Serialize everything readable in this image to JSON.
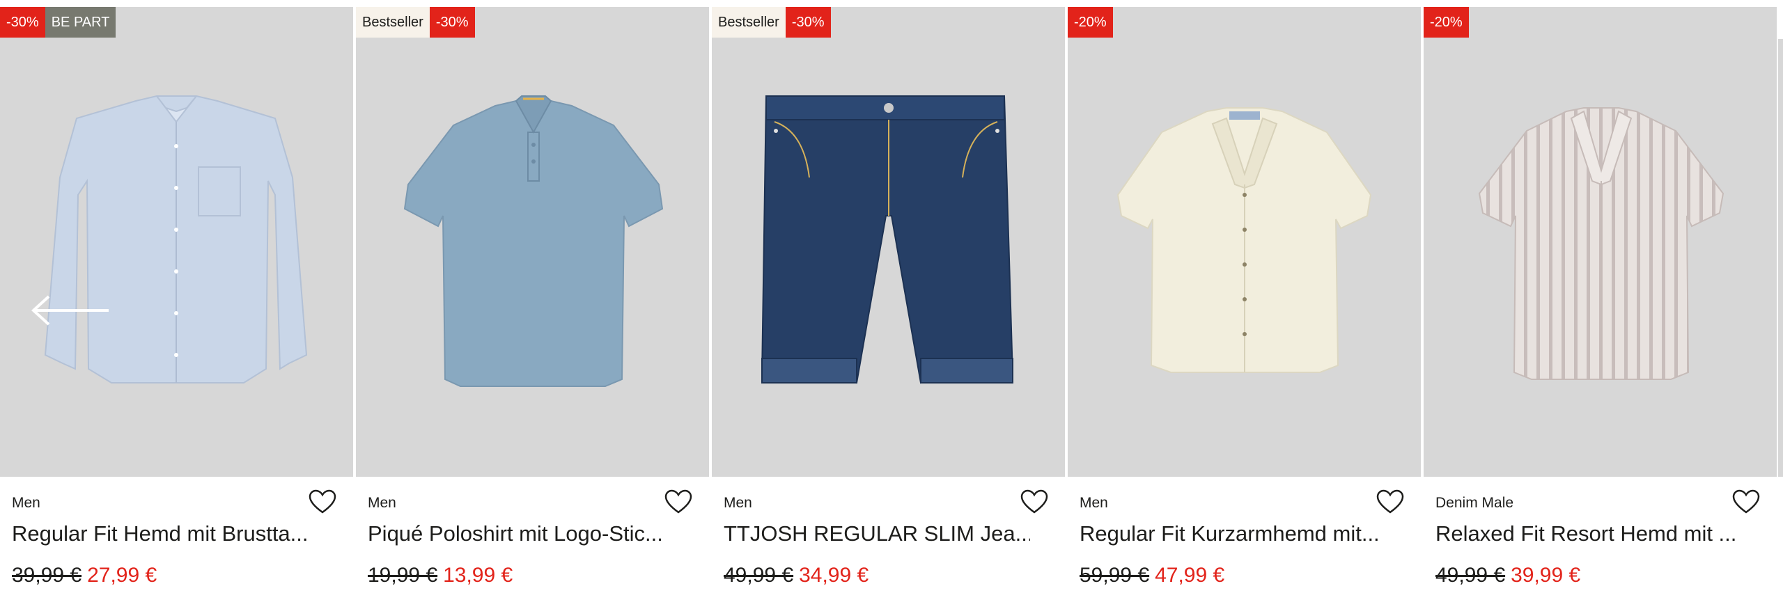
{
  "colors": {
    "image_bg": "#d7d7d7",
    "sale_red": "#e2231a",
    "bestseller_bg": "#f7f2ea",
    "be_part_bg": "#77796f",
    "text_dark": "#1d1d1b"
  },
  "carousel": {
    "prev_arrow_icon": "arrow-left-icon",
    "products": [
      {
        "badges": [
          {
            "type": "sale",
            "text": "-30%"
          },
          {
            "type": "bepart",
            "text": "BE PART"
          }
        ],
        "product_icon": "long-sleeve-shirt-icon",
        "category": "Men",
        "title": "Regular Fit Hemd mit Brustta...",
        "old_price": "39,99 €",
        "new_price": "27,99 €",
        "wishlist_icon": "heart-icon"
      },
      {
        "badges": [
          {
            "type": "bestseller",
            "text": "Bestseller"
          },
          {
            "type": "sale",
            "text": "-30%"
          }
        ],
        "product_icon": "polo-shirt-icon",
        "category": "Men",
        "title": "Piqué Poloshirt mit Logo-Stic...",
        "old_price": "19,99 €",
        "new_price": "13,99 €",
        "wishlist_icon": "heart-icon"
      },
      {
        "badges": [
          {
            "type": "bestseller",
            "text": "Bestseller"
          },
          {
            "type": "sale",
            "text": "-30%"
          }
        ],
        "product_icon": "denim-shorts-icon",
        "category": "Men",
        "title": "TTJOSH REGULAR SLIM Jea...",
        "old_price": "49,99 €",
        "new_price": "34,99 €",
        "wishlist_icon": "heart-icon"
      },
      {
        "badges": [
          {
            "type": "sale",
            "text": "-20%"
          }
        ],
        "product_icon": "short-sleeve-shirt-icon",
        "category": "Men",
        "title": "Regular Fit Kurzarmhemd mit...",
        "old_price": "59,99 €",
        "new_price": "47,99 €",
        "wishlist_icon": "heart-icon"
      },
      {
        "badges": [
          {
            "type": "sale",
            "text": "-20%"
          }
        ],
        "product_icon": "striped-resort-shirt-icon",
        "category": "Denim Male",
        "title": "Relaxed Fit Resort Hemd mit ...",
        "old_price": "49,99 €",
        "new_price": "39,99 €",
        "wishlist_icon": "heart-icon"
      }
    ]
  }
}
